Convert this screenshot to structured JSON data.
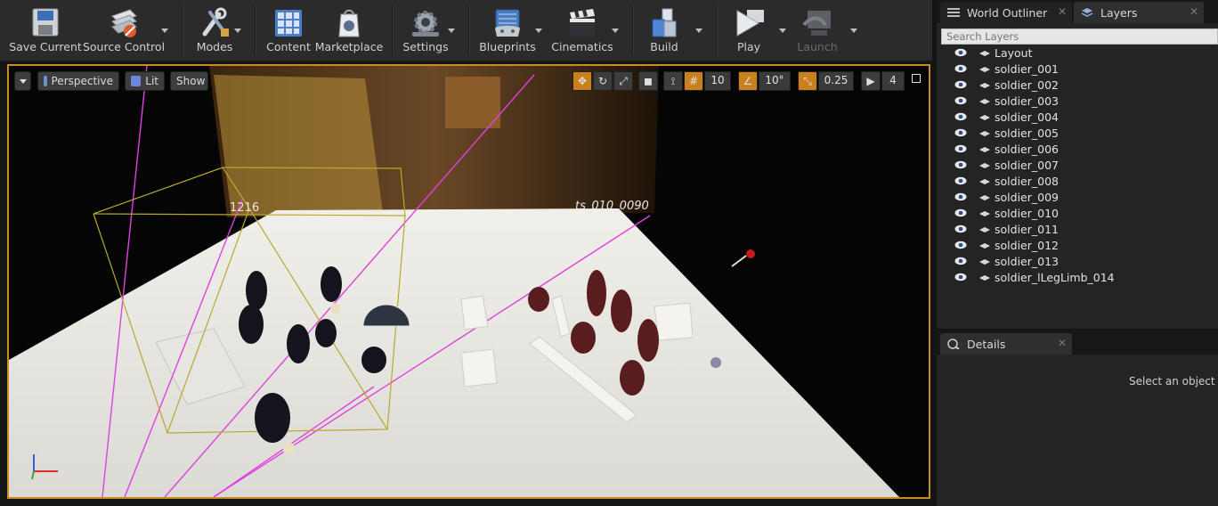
{
  "toolbar": {
    "save_current": "Save Current",
    "source_control": "Source Control",
    "modes": "Modes",
    "content": "Content",
    "marketplace": "Marketplace",
    "settings": "Settings",
    "blueprints": "Blueprints",
    "cinematics": "Cinematics",
    "build": "Build",
    "play": "Play",
    "launch": "Launch"
  },
  "viewport": {
    "perspective": "Perspective",
    "lit": "Lit",
    "show": "Show",
    "grid_snap": "10",
    "rotation_snap": "10°",
    "scale_snap": "0.25",
    "camera_speed": "4",
    "label_1216": "1216",
    "label_shot": "ts_010_0090",
    "axis_x": "X",
    "axis_y": "Y",
    "axis_z": "Z"
  },
  "outliner": {
    "world_outliner_tab": "World Outliner",
    "layers_tab": "Layers",
    "search_placeholder": "Search Layers",
    "layers": [
      "Layout",
      "soldier_001",
      "soldier_002",
      "soldier_003",
      "soldier_004",
      "soldier_005",
      "soldier_006",
      "soldier_007",
      "soldier_008",
      "soldier_009",
      "soldier_010",
      "soldier_011",
      "soldier_012",
      "soldier_013",
      "soldier_lLegLimb_014"
    ]
  },
  "details": {
    "tab": "Details",
    "empty_text": "Select an object to"
  },
  "colors": {
    "accent": "#c98d25",
    "panel": "#242424",
    "toolbar": "#2b2b2b"
  }
}
